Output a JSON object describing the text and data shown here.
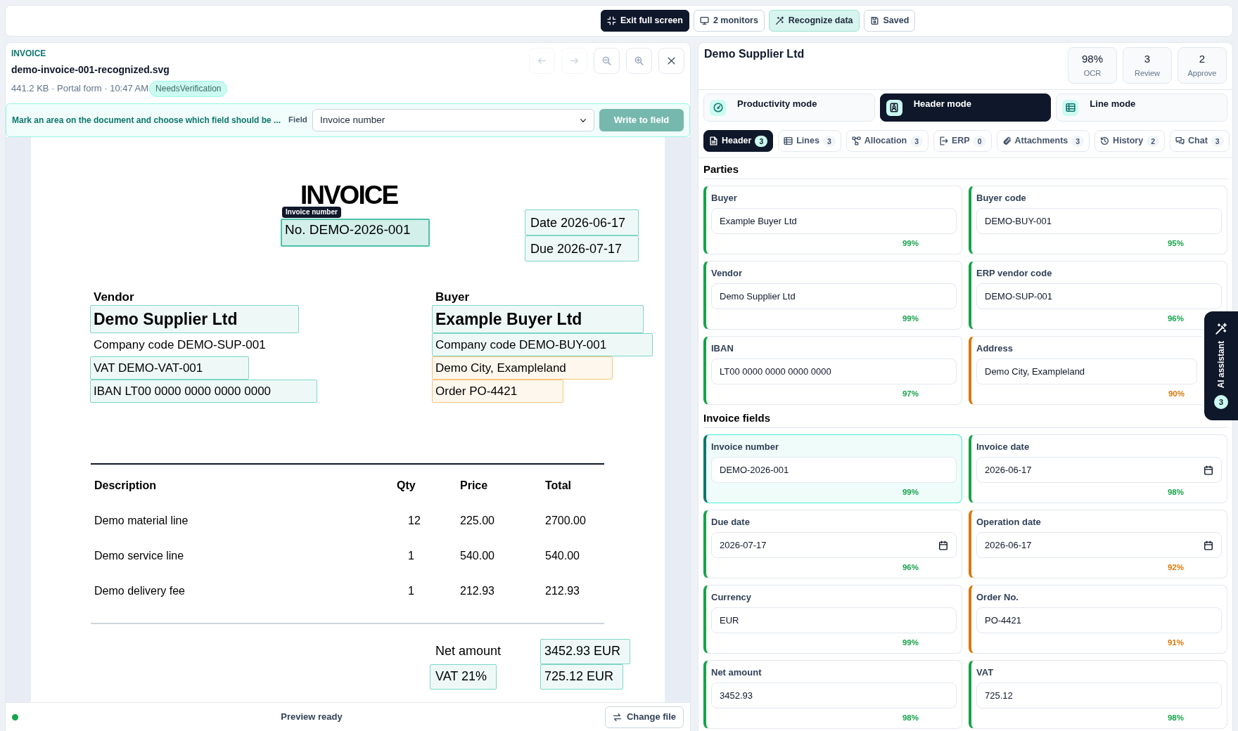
{
  "toolbar": {
    "buttons": [
      {
        "kind": "exit_fullscreen",
        "label": "Exit full screen"
      },
      {
        "kind": "monitors",
        "label": "2 monitors"
      },
      {
        "kind": "recognize",
        "label": "Recognize data"
      },
      {
        "kind": "save",
        "label": "Saved"
      }
    ]
  },
  "document_panel": {
    "type_label": "INVOICE",
    "file_name": "demo-invoice-001-recognized.svg",
    "meta": "441.2 KB · Portal form · 10:47 AM",
    "badge": "NeedsVerification",
    "nav_buttons": [
      {
        "kind": "previous",
        "disabled": true
      },
      {
        "kind": "next",
        "disabled": true
      },
      {
        "kind": "zoom_out",
        "disabled": false
      },
      {
        "kind": "zoom_in",
        "disabled": false
      },
      {
        "kind": "close",
        "disabled": false
      }
    ],
    "mark_bar": {
      "hint": "Mark an area on the document and choose which field should be ...",
      "field_label": "Field",
      "field_select": "Invoice number",
      "write_button": {
        "label": "Write to field",
        "disabled": true
      }
    },
    "document": {
      "title": "INVOICE",
      "number": {
        "text": "No. DEMO-2026-001",
        "region": {
          "color": "#4fc0aa",
          "selected": true,
          "tag": "Invoice number"
        }
      },
      "dates": [
        {
          "text": "Date 2026-06-17",
          "region": {
            "color": "#7ed5c5",
            "selected": false
          }
        },
        {
          "text": "Due 2026-07-17",
          "region": {
            "color": "#7ed5c5",
            "selected": false
          }
        }
      ],
      "parties": [
        {
          "heading": "Vendor",
          "lines": [
            {
              "kind": "name",
              "text": "Demo Supplier Ltd",
              "region": {
                "color": "#7ed5c5",
                "selected": false
              }
            },
            {
              "kind": "detail",
              "text": "Company code DEMO-SUP-001"
            },
            {
              "kind": "detail",
              "text": "VAT DEMO-VAT-001",
              "region": {
                "color": "#7ed5c5",
                "selected": false
              }
            },
            {
              "kind": "detail",
              "text": "IBAN LT00 0000 0000 0000 0000",
              "region": {
                "color": "#7ed5c5",
                "selected": false
              }
            }
          ]
        },
        {
          "heading": "Buyer",
          "lines": [
            {
              "kind": "name",
              "text": "Example Buyer Ltd",
              "region": {
                "color": "#7ed5c5",
                "selected": false
              }
            },
            {
              "kind": "detail",
              "text": "Company code DEMO-BUY-001",
              "region": {
                "color": "#7ed5c5",
                "selected": false
              }
            },
            {
              "kind": "detail",
              "text": "Demo City, Exampleland",
              "region": {
                "color": "#f6c47a",
                "selected": false
              }
            },
            {
              "kind": "detail",
              "text": "Order PO-4421",
              "region": {
                "color": "#f6c47a",
                "selected": false
              }
            }
          ]
        }
      ],
      "table": {
        "columns": [
          "Description",
          "Qty",
          "Price",
          "Total"
        ],
        "rows": [
          [
            "Demo material line",
            "12",
            "225.00",
            "2700.00"
          ],
          [
            "Demo service line",
            "1",
            "540.00",
            "540.00"
          ],
          [
            "Demo delivery fee",
            "1",
            "212.93",
            "212.93"
          ]
        ]
      },
      "totals": [
        {
          "label": "Net amount",
          "value": "3452.93 EUR",
          "value_region": {
            "color": "#7ed5c5",
            "selected": false
          }
        },
        {
          "label": "VAT 21%",
          "label_region": {
            "color": "#7ed5c5",
            "selected": false
          },
          "value": "725.12 EUR",
          "value_region": {
            "color": "#7ed5c5",
            "selected": false
          }
        }
      ]
    },
    "status_bar": {
      "status": "Preview ready",
      "change_file": "Change file"
    }
  },
  "record_panel": {
    "title": "Demo Supplier Ltd",
    "stats": [
      {
        "value": "98%",
        "label": "OCR"
      },
      {
        "value": "3",
        "label": "Review"
      },
      {
        "value": "2",
        "label": "Approve"
      }
    ],
    "modes": [
      {
        "kind": "productivity",
        "label": "Productivity mode",
        "selected": false
      },
      {
        "kind": "header",
        "label": "Header mode",
        "selected": true
      },
      {
        "kind": "lines",
        "label": "Line mode",
        "selected": false
      }
    ],
    "tabs": [
      {
        "kind": "header",
        "label": "Header",
        "count": "3",
        "selected": true
      },
      {
        "kind": "lines",
        "label": "Lines",
        "count": "3",
        "selected": false
      },
      {
        "kind": "allocation",
        "label": "Allocation",
        "count": "3",
        "selected": false
      },
      {
        "kind": "erp",
        "label": "ERP",
        "count": "0",
        "selected": false
      },
      {
        "kind": "attachments",
        "label": "Attachments",
        "count": "3",
        "selected": false
      },
      {
        "kind": "history",
        "label": "History",
        "count": "2",
        "selected": false
      },
      {
        "kind": "chat",
        "label": "Chat",
        "count": "3",
        "selected": false
      }
    ],
    "sections": [
      {
        "title": "Parties",
        "fields": [
          {
            "kind": "text",
            "label": "Buyer",
            "value": "Example Buyer Ltd",
            "confidence": "99%",
            "color": "#16a34a",
            "selected": false
          },
          {
            "kind": "text",
            "label": "Buyer code",
            "value": "DEMO-BUY-001",
            "confidence": "95%",
            "color": "#16a34a",
            "selected": false
          },
          {
            "kind": "text",
            "label": "Vendor",
            "value": "Demo Supplier Ltd",
            "confidence": "99%",
            "color": "#16a34a",
            "selected": false
          },
          {
            "kind": "text",
            "label": "ERP vendor code",
            "value": "DEMO-SUP-001",
            "confidence": "96%",
            "color": "#16a34a",
            "selected": false
          },
          {
            "kind": "text",
            "label": "IBAN",
            "value": "LT00 0000 0000 0000 0000",
            "confidence": "97%",
            "color": "#16a34a",
            "selected": false
          },
          {
            "kind": "text",
            "label": "Address",
            "value": "Demo City, Exampleland",
            "confidence": "90%",
            "color": "#d97706",
            "selected": false
          }
        ]
      },
      {
        "title": "Invoice fields",
        "fields": [
          {
            "kind": "text",
            "label": "Invoice number",
            "value": "DEMO-2026-001",
            "confidence": "99%",
            "color": "#16a34a",
            "selected": true
          },
          {
            "kind": "date",
            "label": "Invoice date",
            "value": "2026-06-17",
            "confidence": "98%",
            "color": "#16a34a",
            "selected": false
          },
          {
            "kind": "date",
            "label": "Due date",
            "value": "2026-07-17",
            "confidence": "96%",
            "color": "#16a34a",
            "selected": false
          },
          {
            "kind": "date",
            "label": "Operation date",
            "value": "2026-06-17",
            "confidence": "92%",
            "color": "#d97706",
            "selected": false
          },
          {
            "kind": "text",
            "label": "Currency",
            "value": "EUR",
            "confidence": "99%",
            "color": "#16a34a",
            "selected": false
          },
          {
            "kind": "text",
            "label": "Order No.",
            "value": "PO-4421",
            "confidence": "91%",
            "color": "#d97706",
            "selected": false
          },
          {
            "kind": "text",
            "label": "Net amount",
            "value": "3452.93",
            "confidence": "98%",
            "color": "#16a34a",
            "selected": false
          },
          {
            "kind": "text",
            "label": "VAT",
            "value": "725.12",
            "confidence": "98%",
            "color": "#16a34a",
            "selected": false
          }
        ]
      }
    ]
  },
  "assistant_tab": {
    "label": "AI assistant",
    "count": "3"
  }
}
